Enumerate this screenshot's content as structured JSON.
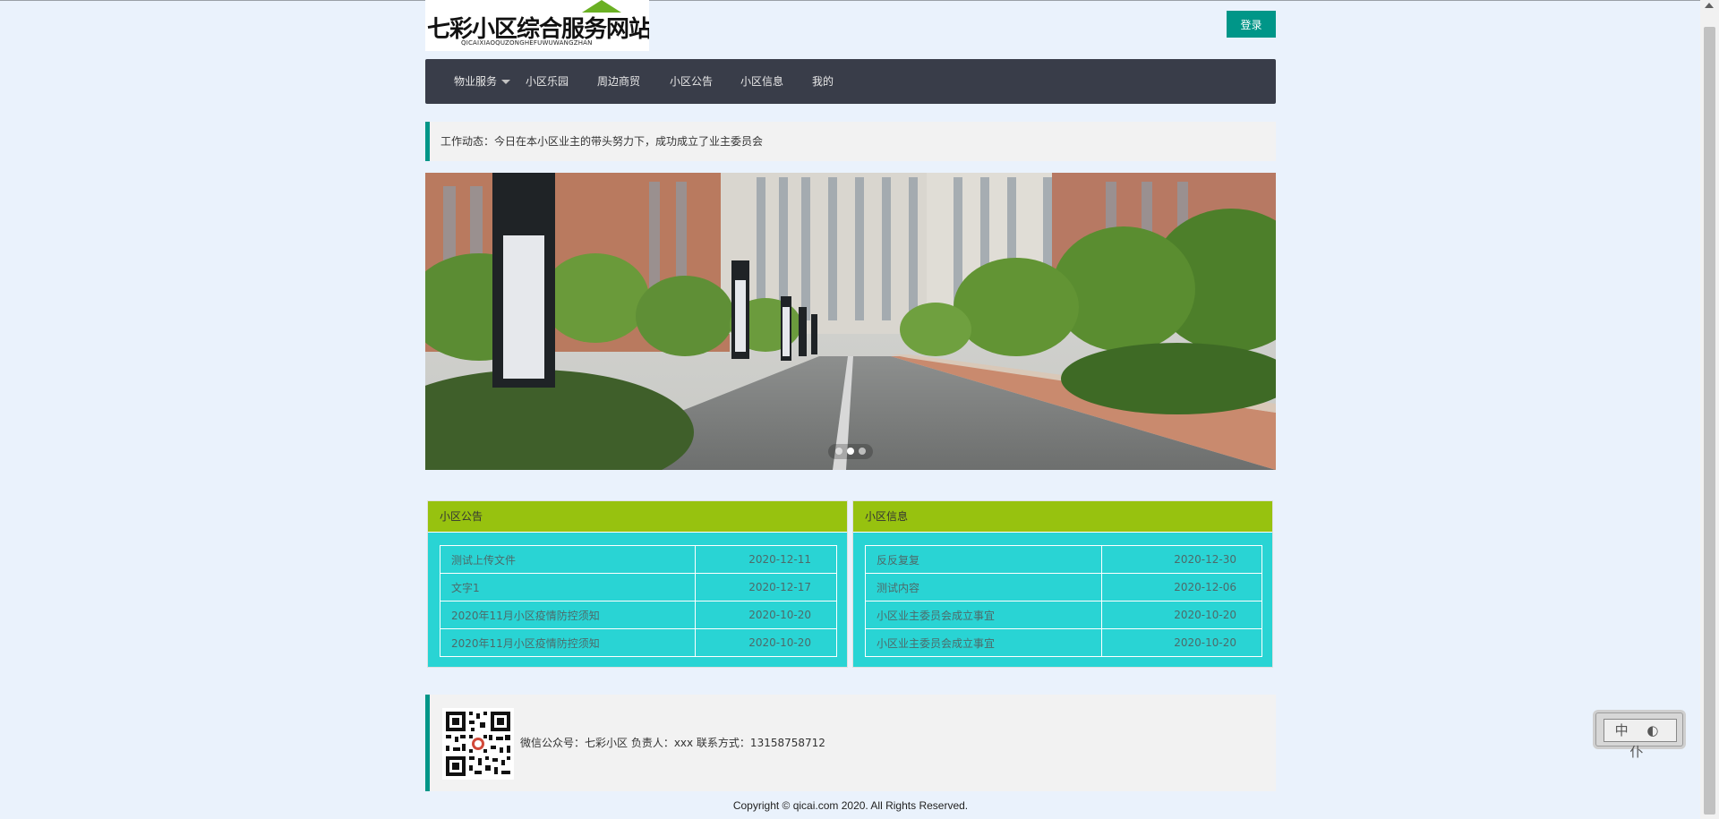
{
  "header": {
    "logo_title": "七彩小区综合服务网站",
    "logo_subtitle": "QICAIXIAOQUZONGHEFUWUWANGZHAN",
    "login_label": "登录"
  },
  "nav": {
    "items": [
      {
        "label": "物业服务",
        "has_dropdown": true
      },
      {
        "label": "小区乐园"
      },
      {
        "label": "周边商贸"
      },
      {
        "label": "小区公告"
      },
      {
        "label": "小区信息"
      },
      {
        "label": "我的"
      }
    ]
  },
  "notice": {
    "text": "工作动态：今日在本小区业主的带头努力下，成功成立了业主委员会"
  },
  "carousel": {
    "slide_count": 3,
    "active_index": 1
  },
  "announcements": {
    "title": "小区公告",
    "rows": [
      {
        "title": "测试上传文件",
        "date": "2020-12-11"
      },
      {
        "title": "文字1",
        "date": "2020-12-17"
      },
      {
        "title": "2020年11月小区疫情防控须知",
        "date": "2020-10-20"
      },
      {
        "title": "2020年11月小区疫情防控须知",
        "date": "2020-10-20"
      }
    ]
  },
  "community_info": {
    "title": "小区信息",
    "rows": [
      {
        "title": "反反复复",
        "date": "2020-12-30"
      },
      {
        "title": "测试内容",
        "date": "2020-12-06"
      },
      {
        "title": "小区业主委员会成立事宜",
        "date": "2020-10-20"
      },
      {
        "title": "小区业主委员会成立事宜",
        "date": "2020-10-20"
      }
    ]
  },
  "footer": {
    "contact": "微信公众号：七彩小区 负责人：xxx 联系方式：13158758712",
    "copyright": "Copyright © qicai.com 2020. All Rights Reserved."
  },
  "ime": {
    "text": "中 ◐ 仆"
  },
  "colors": {
    "page_bg": "#eaf2fc",
    "nav_bg": "#393d49",
    "accent": "#009688",
    "panel_head": "#97c20f",
    "panel_body": "#29d4d4"
  }
}
